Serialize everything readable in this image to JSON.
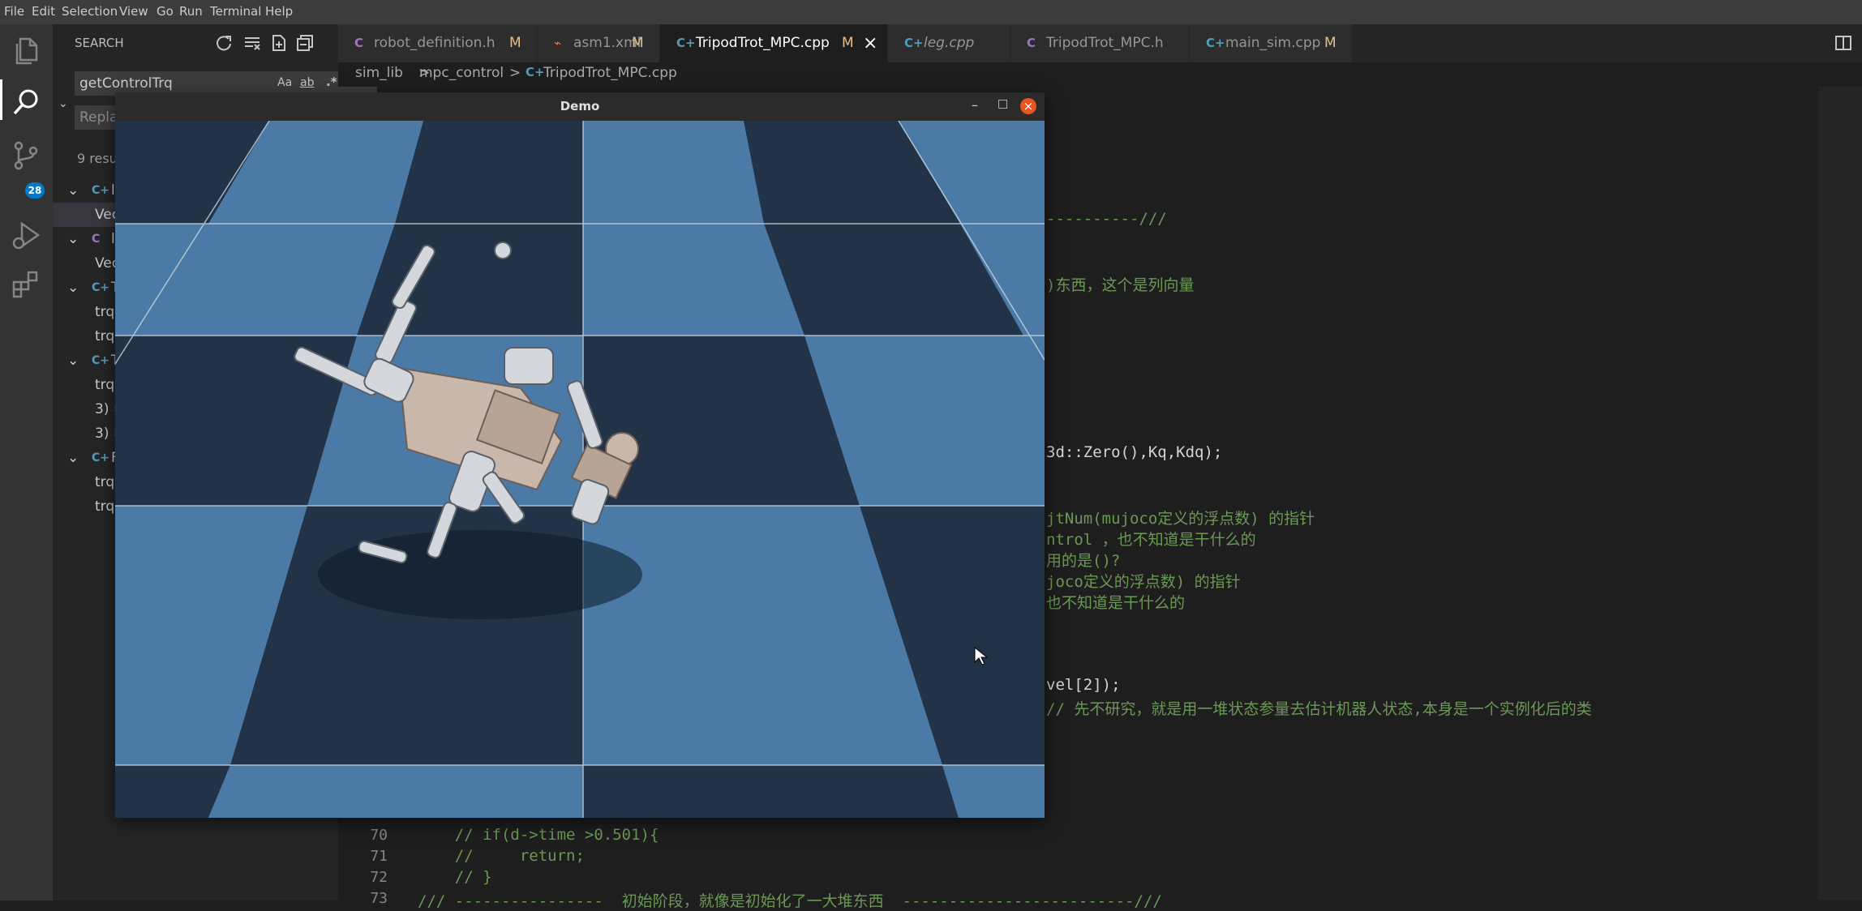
{
  "menu": [
    "File",
    "Edit",
    "Selection",
    "View",
    "Go",
    "Run",
    "Terminal",
    "Help"
  ],
  "activity": {
    "scm_badge": "28"
  },
  "sidebar": {
    "title": "SEARCH",
    "search_value": "getControlTrq",
    "option_case": "Aa",
    "option_word": "ab",
    "option_regex": ".*",
    "replace_placeholder": "Repla",
    "results_count": "9 resu",
    "tree": [
      {
        "icon": "C+",
        "label": "l",
        "kind": "file"
      },
      {
        "label": "Vec",
        "kind": "match",
        "selected": true
      },
      {
        "icon": "C",
        "label": "l",
        "kind": "file"
      },
      {
        "label": "Vec",
        "kind": "match"
      },
      {
        "icon": "C+",
        "label": "T",
        "kind": "file"
      },
      {
        "label": "trq",
        "kind": "match"
      },
      {
        "label": "trq",
        "kind": "match"
      },
      {
        "icon": "C+",
        "label": "T",
        "kind": "file"
      },
      {
        "label": "trq",
        "kind": "match"
      },
      {
        "label": "3) =",
        "kind": "match"
      },
      {
        "label": "3) =",
        "kind": "match"
      },
      {
        "icon": "C+",
        "label": "F",
        "kind": "file"
      },
      {
        "label": "trq",
        "kind": "match"
      },
      {
        "label": "trq",
        "kind": "match"
      }
    ]
  },
  "tabs": [
    {
      "icon": "C",
      "label": "robot_definition.h",
      "mod": "M",
      "active": false,
      "italic": false
    },
    {
      "icon": "xml",
      "label": "asm1.xml",
      "mod": "M",
      "active": false,
      "italic": false
    },
    {
      "icon": "C+",
      "label": "TripodTrot_MPC.cpp",
      "mod": "M",
      "active": true,
      "italic": false,
      "close": "×"
    },
    {
      "icon": "C+",
      "label": "leg.cpp",
      "mod": "",
      "active": false,
      "italic": true
    },
    {
      "icon": "C",
      "label": "TripodTrot_MPC.h",
      "mod": "",
      "active": false,
      "italic": false
    },
    {
      "icon": "C+",
      "label": "main_sim.cpp",
      "mod": "M",
      "active": false,
      "italic": false
    }
  ],
  "breadcrumb": {
    "part1": "sim_lib",
    "sep": ">",
    "part2": "mpc_control",
    "part3": "TripodTrot_MPC.cpp"
  },
  "code_fragments": [
    {
      "text": "----------///",
      "cls": "cm"
    },
    {
      "text": ")东西，这个是列向量",
      "cls": "cm"
    },
    {
      "text": "3d::Zero(),Kq,Kdq);",
      "cls": ""
    },
    {
      "text": "jtNum(mujoco定义的浮点数) 的指针",
      "cls": "cm"
    },
    {
      "text": "ntrol ，也不知道是干什么的",
      "cls": "cm"
    },
    {
      "text": "用的是()?",
      "cls": "cm"
    },
    {
      "text": "joco定义的浮点数) 的指针",
      "cls": "cm"
    },
    {
      "text": "也不知道是干什么的",
      "cls": "cm"
    },
    {
      "text": "vel[2]);",
      "cls": ""
    },
    {
      "text": "// 先不研究，就是用一堆状态参量去估计机器人状态,本身是一个实例化后的类",
      "cls": "cm"
    }
  ],
  "code_lines": [
    {
      "num": "70",
      "text": "    // if(d->time >0.501){"
    },
    {
      "num": "71",
      "text": "    //     return;"
    },
    {
      "num": "72",
      "text": "    // }"
    },
    {
      "num": "73",
      "text": "/// ----------------  初始阶段，就像是初始化了一大堆东西  -------------------------///"
    }
  ],
  "demo_window": {
    "title": "Demo",
    "btn_min": "–",
    "btn_max": "□",
    "btn_close": "×"
  },
  "colors": {
    "accent": "#007acc",
    "tile_light": "#4a7aa5",
    "tile_dark": "#223247",
    "close_red": "#e95420",
    "badge": "#007acc"
  },
  "icons": [
    "files-icon",
    "search-icon",
    "source-control-icon",
    "run-debug-icon",
    "extensions-icon",
    "refresh-icon",
    "clear-icon",
    "new-file-icon",
    "collapse-icon",
    "split-icon"
  ]
}
